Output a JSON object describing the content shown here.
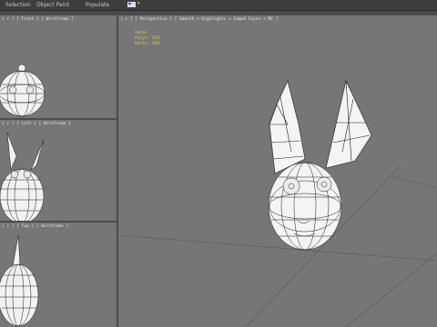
{
  "menubar": {
    "items": [
      {
        "label": "Selection"
      },
      {
        "label": "Object Paint"
      },
      {
        "label": "Populate"
      }
    ],
    "flag_icon": "flag-icon"
  },
  "viewports": {
    "top_left": {
      "label": "[ + ] [ Front ] [ Wireframe ]"
    },
    "mid_left": {
      "label": "[ + ] [ Left ] [ Wireframe ]"
    },
    "bot_left": {
      "label": "[ + ] [ Top ] [ Wireframe ]"
    },
    "main": {
      "label": "[ + ] [ Perspective ] [ Smooth + Highlights + Edged Faces + ME ]",
      "stats": {
        "total": "Total",
        "polys": "Polys: 370",
        "verts": "Verts: 330"
      }
    }
  },
  "colors": {
    "menubar": "#3d3d3d",
    "viewport_bg": "#767676",
    "grid_line": "#5a5a5a",
    "stats_text": "#e6d64a",
    "mesh_fill": "#f4f4f4",
    "wire": "#1a1a1a"
  }
}
